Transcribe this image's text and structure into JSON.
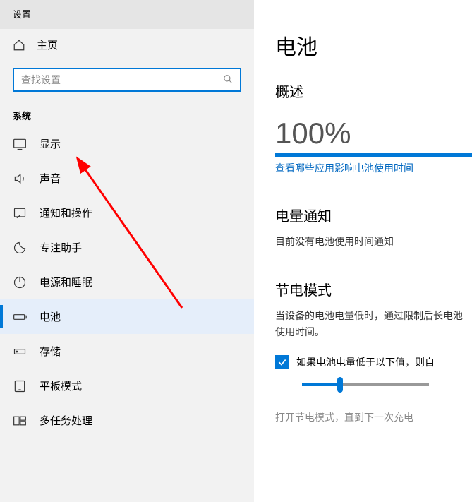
{
  "app": {
    "title": "设置"
  },
  "sidebar": {
    "home": "主页",
    "search_placeholder": "查找设置",
    "group": "系统",
    "items": [
      {
        "label": "显示"
      },
      {
        "label": "声音"
      },
      {
        "label": "通知和操作"
      },
      {
        "label": "专注助手"
      },
      {
        "label": "电源和睡眠"
      },
      {
        "label": "电池"
      },
      {
        "label": "存储"
      },
      {
        "label": "平板模式"
      },
      {
        "label": "多任务处理"
      }
    ]
  },
  "content": {
    "page_title": "电池",
    "overview_heading": "概述",
    "battery_percent": "100%",
    "link_apps": "查看哪些应用影响电池使用时间",
    "notify_heading": "电量通知",
    "notify_text": "目前没有电池使用时间通知",
    "saver_heading": "节电模式",
    "saver_text": "当设备的电池电量低时，通过限制后长电池使用时间。",
    "saver_checkbox": "如果电池电量低于以下值，则自",
    "saver_note": "打开节电模式，直到下一次充电"
  }
}
